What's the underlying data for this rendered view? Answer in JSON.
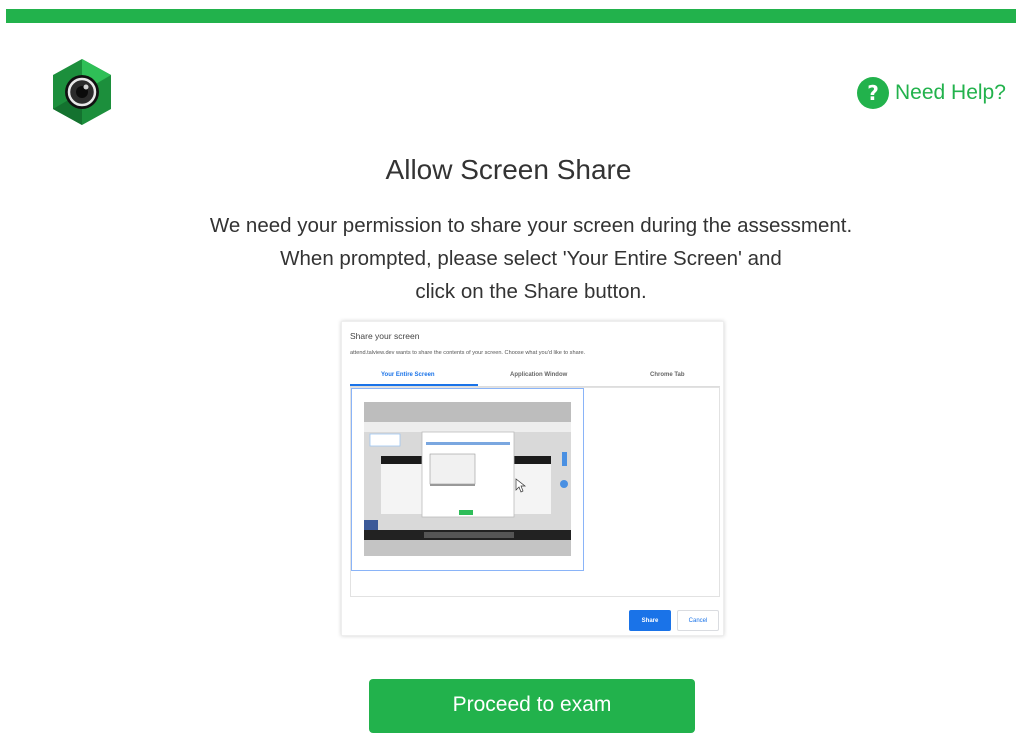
{
  "brand": {
    "accent_color": "#22b24c",
    "logo_icon": "camera-lens-hexagon-icon"
  },
  "help": {
    "icon": "question-circle-icon",
    "label": "Need Help?"
  },
  "main": {
    "title": "Allow Screen Share",
    "description_lines": [
      "We need your permission to share your screen during the assessment.",
      "When prompted, please select 'Your Entire Screen' and",
      "click on the Share button."
    ]
  },
  "share_dialog": {
    "title": "Share your screen",
    "subtitle": "attend.talview.dev wants to share the contents of your screen. Choose what you'd like to share.",
    "tabs": [
      {
        "label": "Your Entire Screen",
        "active": true
      },
      {
        "label": "Application Window",
        "active": false
      },
      {
        "label": "Chrome Tab",
        "active": false
      }
    ],
    "share_label": "Share",
    "cancel_label": "Cancel",
    "accent_color": "#1a73e8"
  },
  "actions": {
    "proceed_label": "Proceed to exam"
  }
}
